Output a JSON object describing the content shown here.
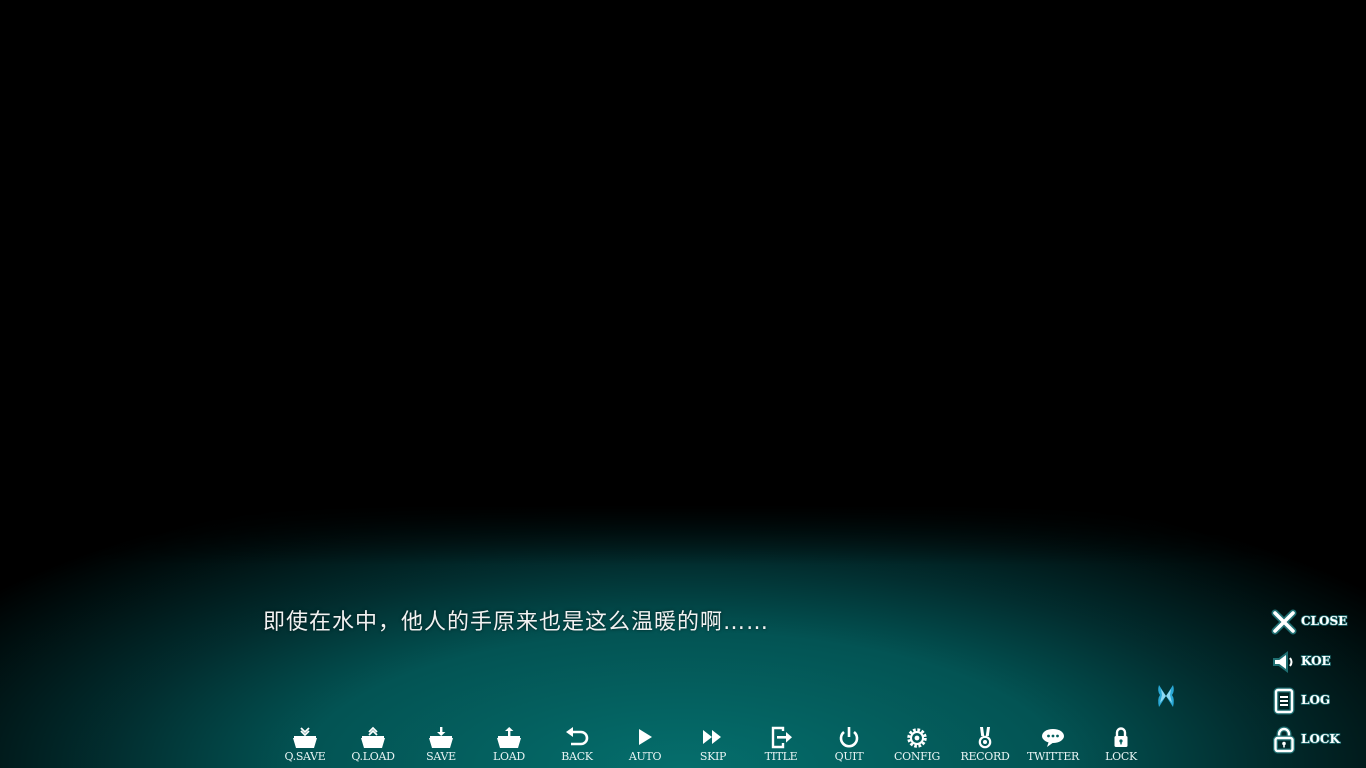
{
  "dialogue": {
    "text": "即使在水中，他人的手原来也是这么温暖的啊……"
  },
  "page_indicator": {
    "icon": "butterfly-icon",
    "color": "#2fb6e8"
  },
  "toolbar": {
    "items": [
      {
        "label": "Q.SAVE",
        "icon": "quick-save-icon"
      },
      {
        "label": "Q.LOAD",
        "icon": "quick-load-icon"
      },
      {
        "label": "SAVE",
        "icon": "save-icon"
      },
      {
        "label": "LOAD",
        "icon": "load-icon"
      },
      {
        "label": "BACK",
        "icon": "back-arrow-icon"
      },
      {
        "label": "AUTO",
        "icon": "play-icon"
      },
      {
        "label": "SKIP",
        "icon": "fast-forward-icon"
      },
      {
        "label": "TITLE",
        "icon": "exit-to-title-icon"
      },
      {
        "label": "QUIT",
        "icon": "power-icon"
      },
      {
        "label": "CONFIG",
        "icon": "gear-icon"
      },
      {
        "label": "RECORD",
        "icon": "medal-icon"
      },
      {
        "label": "TWITTER",
        "icon": "speech-bubble-icon"
      },
      {
        "label": "LOCK",
        "icon": "lock-icon"
      }
    ]
  },
  "sidemenu": {
    "items": [
      {
        "label": "CLOSE",
        "icon": "close-x-icon"
      },
      {
        "label": "KOE",
        "icon": "speaker-icon"
      },
      {
        "label": "LOG",
        "icon": "log-document-icon"
      },
      {
        "label": "LOCK",
        "icon": "padlock-icon"
      }
    ]
  },
  "colors": {
    "background": "#000000",
    "textbox_teal": "#056e6c",
    "text": "#f2f2f2",
    "icon_outline": "#1f6f72"
  }
}
